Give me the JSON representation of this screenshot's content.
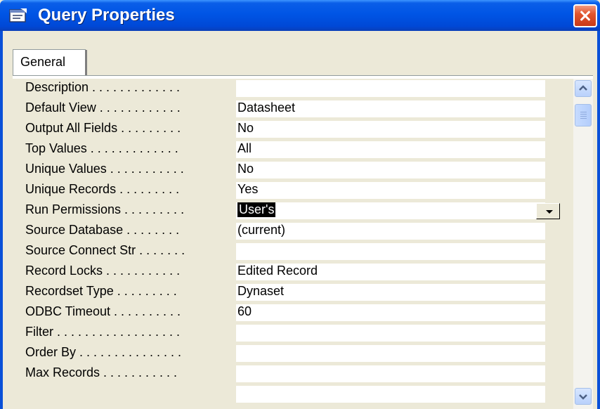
{
  "window": {
    "title": "Query Properties"
  },
  "tabs": [
    {
      "label": "General"
    }
  ],
  "properties": [
    {
      "label": "Description . . . . . . . . . . . . .",
      "value": ""
    },
    {
      "label": "Default View . . . . . . . . . . . .",
      "value": "Datasheet"
    },
    {
      "label": "Output All Fields . . . . . . . . .",
      "value": "No"
    },
    {
      "label": "Top Values . . . . . . . . . . . . .",
      "value": "All"
    },
    {
      "label": "Unique Values . . . . . . . . . . .",
      "value": "No"
    },
    {
      "label": "Unique Records . . . . . . . . .",
      "value": "Yes"
    },
    {
      "label": "Run Permissions . . . . . . . . .",
      "value": "User's",
      "selected": true,
      "dropdown": true
    },
    {
      "label": "Source Database . . . . . . . .",
      "value": "(current)"
    },
    {
      "label": "Source Connect Str . . . . . . .",
      "value": ""
    },
    {
      "label": "Record Locks . . . . . . . . . . .",
      "value": "Edited Record"
    },
    {
      "label": "Recordset Type . . . . . . . . .",
      "value": "Dynaset"
    },
    {
      "label": "ODBC Timeout . . . . . . . . . .",
      "value": "60"
    },
    {
      "label": "Filter . . . . . . . . . . . . . . . . . .",
      "value": ""
    },
    {
      "label": "Order By . . . . . . . . . . . . . . .",
      "value": ""
    },
    {
      "label": "Max Records . . . . . . . . . . .",
      "value": ""
    }
  ],
  "icons": {
    "title": "properties-sheet-icon",
    "close": "close-icon",
    "scroll_up": "scroll-up-arrow-icon",
    "scroll_down": "scroll-down-arrow-icon",
    "dropdown": "dropdown-arrow-icon"
  },
  "colors": {
    "titlebar": "#0055e5",
    "close": "#e2552e",
    "face": "#ece9d8"
  }
}
